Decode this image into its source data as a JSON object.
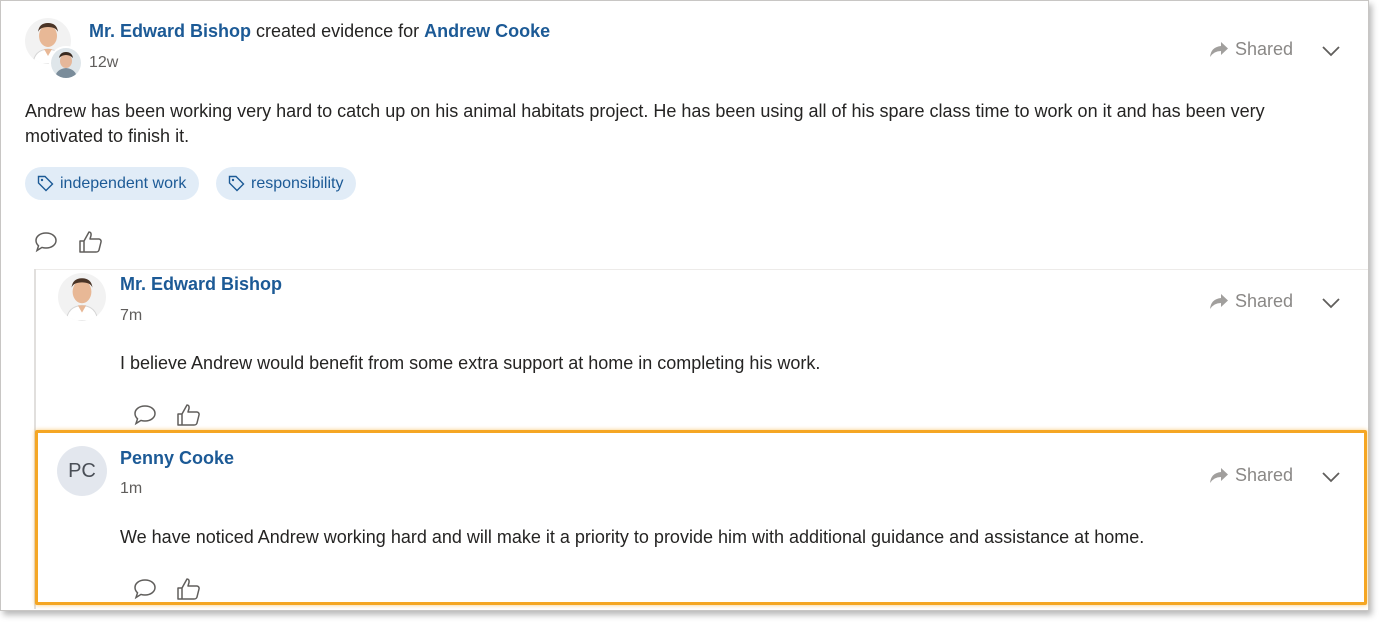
{
  "post": {
    "author": "Mr. Edward Bishop",
    "action": " created evidence for ",
    "subject": "Andrew Cooke",
    "time": "12w",
    "body": "Andrew has been working very hard to catch up on his animal habitats project. He has been using all of his spare class time to work on it and has been very motivated to finish it.",
    "tags": [
      "independent work",
      "responsibility"
    ],
    "shared_label": "Shared"
  },
  "comments": [
    {
      "author": "Mr. Edward Bishop",
      "time": "7m",
      "body": "I believe Andrew would benefit from some extra support at home in completing his work.",
      "shared_label": "Shared"
    },
    {
      "author": "Penny Cooke",
      "initials": "PC",
      "time": "1m",
      "body": "We have noticed Andrew working hard and will make it a priority to provide him with additional guidance and assistance at home.",
      "shared_label": "Shared"
    }
  ],
  "colors": {
    "link": "#1c5a96",
    "tag_bg": "#e1ecf7",
    "highlight": "#f5a623",
    "muted": "#8a8886"
  },
  "icons": [
    "tag-icon",
    "comment-icon",
    "like-icon",
    "share-arrow-icon",
    "chevron-down-icon"
  ]
}
